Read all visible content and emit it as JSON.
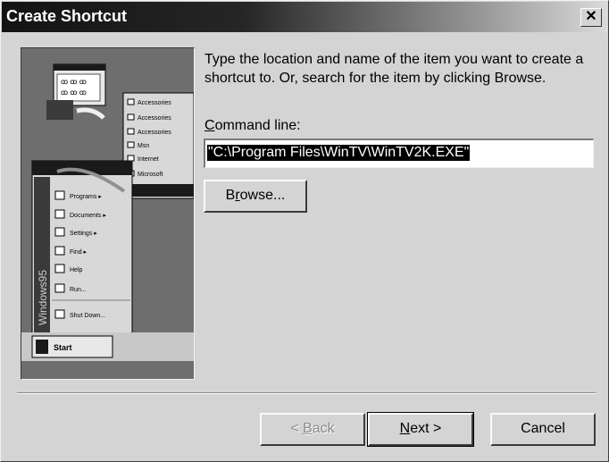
{
  "window": {
    "title": "Create Shortcut",
    "close_glyph": "✕"
  },
  "instructions": "Type the location and name of the item you want to create a shortcut to. Or, search for the item by clicking Browse.",
  "command_line": {
    "label_prefix": "C",
    "label_rest": "ommand line:",
    "value": "\"C:\\Program Files\\WinTV\\WinTV2K.EXE\""
  },
  "buttons": {
    "browse_pre": "B",
    "browse_accel": "r",
    "browse_post": "owse...",
    "back_pre": "< ",
    "back_accel": "B",
    "back_post": "ack",
    "next_accel": "N",
    "next_post": "ext >",
    "cancel": "Cancel"
  },
  "illustration": {
    "icon": "shortcut-wizard-illustration",
    "startmenu_brand": "Windows95",
    "taskbar_label": "Start",
    "menu_items": [
      "Programs",
      "Documents",
      "Settings",
      "Find",
      "Help",
      "Run...",
      "Shut Down..."
    ],
    "submenu_items": [
      "Accessories",
      "Accessories",
      "Accessories",
      "Msn",
      "Internet",
      "Microsoft"
    ]
  }
}
